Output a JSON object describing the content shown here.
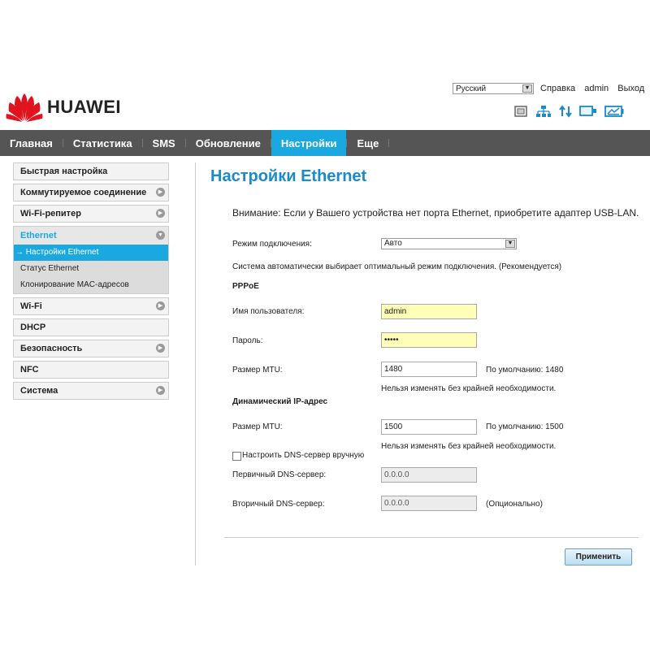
{
  "header": {
    "brand": "HUAWEI",
    "language": "Русский",
    "links": [
      "Справка",
      "admin",
      "Выход"
    ]
  },
  "nav": [
    "Главная",
    "Статистика",
    "SMS",
    "Обновление",
    "Настройки",
    "Еще"
  ],
  "nav_active": "Настройки",
  "sidebar": {
    "items_top": [
      "Быстрая настройка",
      "Коммутируемое соединение",
      "Wi-Fi-репитер"
    ],
    "group": {
      "title": "Ethernet",
      "subs": [
        "Настройки Ethernet",
        "Статус Ethernet",
        "Клонирование MAC-адресов"
      ],
      "active_marker": "→"
    },
    "items_bottom": [
      "Wi-Fi",
      "DHCP",
      "Безопасность",
      "NFC",
      "Система"
    ]
  },
  "main": {
    "title": "Настройки Ethernet",
    "notice": "Внимание: Если у Вашего устройства нет порта Ethernet, приобретите адаптер USB-LAN.",
    "mode_label": "Режим подключения:",
    "mode_value": "Авто",
    "mode_hint": "Система автоматически выбирает оптимальный режим подключения. (Рекомендуется)",
    "pppoe": {
      "section": "PPPoE",
      "user_label": "Имя пользователя:",
      "user_value": "admin",
      "pass_label": "Пароль:",
      "pass_value": "•••••",
      "mtu_label": "Размер MTU:",
      "mtu_value": "1480",
      "mtu_default": "По умолчанию: 1480",
      "mtu_hint": "Нельзя изменять без крайней необходимости."
    },
    "dynamic": {
      "section": "Динамический IP-адрес",
      "mtu_label": "Размер MTU:",
      "mtu_value": "1500",
      "mtu_default": "По умолчанию: 1500",
      "mtu_hint": "Нельзя изменять без крайней необходимости.",
      "dns_manual_label": "Настроить DNS-сервер вручную",
      "dns_manual_checked": false,
      "dns1_label": "Первичный DNS-сервер:",
      "dns1_value": "0.0.0.0",
      "dns2_label": "Вторичный DNS-сервер:",
      "dns2_value": "0.0.0.0",
      "dns2_optional": "(Опционально)"
    },
    "apply_label": "Применить"
  },
  "colors": {
    "accent": "#1aa8e0",
    "nav_bg": "#555555",
    "title": "#1a8ac9",
    "huawei_red": "#e0141e"
  },
  "icons": [
    "sim-icon",
    "network-icon",
    "data-transfer-icon",
    "wifi-icon",
    "battery-icon"
  ]
}
